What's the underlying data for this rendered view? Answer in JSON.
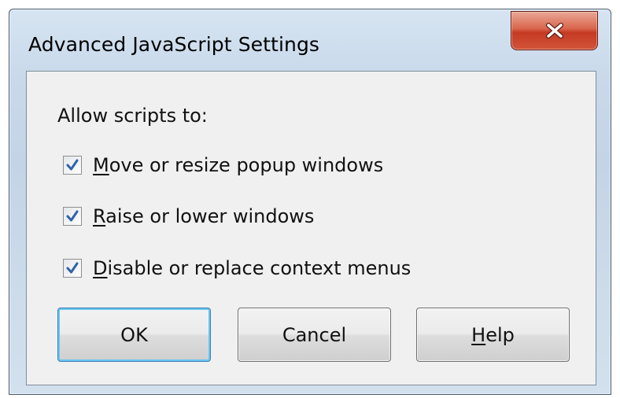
{
  "window": {
    "title": "Advanced JavaScript Settings",
    "close_glyph": "x-icon"
  },
  "dialog": {
    "heading": "Allow scripts to:",
    "options": [
      {
        "mnemonic": "M",
        "rest": "ove or resize popup windows",
        "checked": true
      },
      {
        "mnemonic": "R",
        "rest": "aise or lower windows",
        "checked": true
      },
      {
        "mnemonic": "D",
        "rest": "isable or replace context menus",
        "checked": true
      }
    ]
  },
  "buttons": {
    "ok": "OK",
    "cancel": "Cancel",
    "help_mnemonic": "H",
    "help_rest": "elp"
  },
  "colors": {
    "close_red": "#c43a22",
    "check_blue": "#2f63a8",
    "default_focus": "#69c5f4"
  }
}
